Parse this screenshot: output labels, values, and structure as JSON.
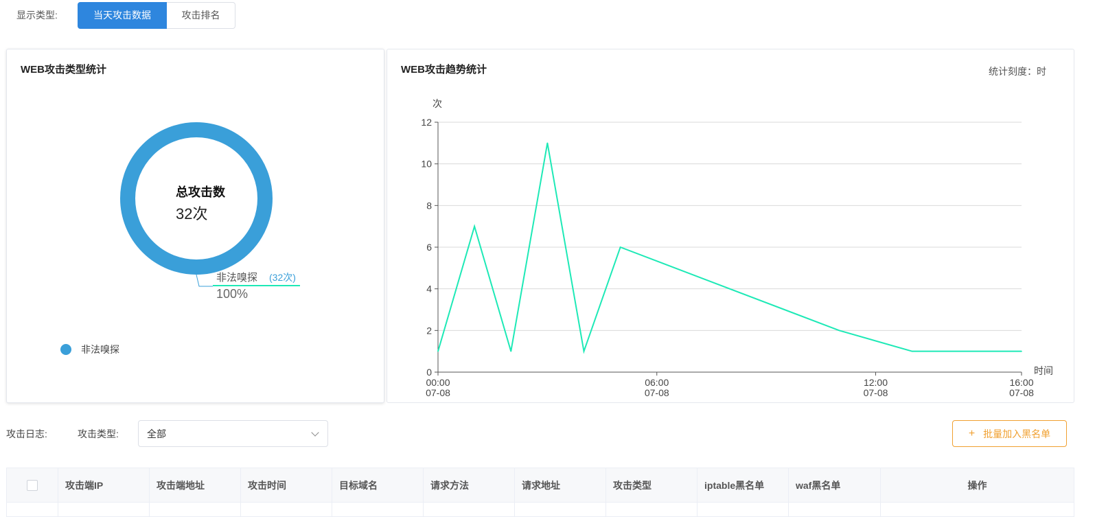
{
  "display_type": {
    "label": "显示类型:",
    "options": [
      "当天攻击数据",
      "攻击排名"
    ],
    "active_index": 0
  },
  "pie_card": {
    "title": "WEB攻击类型统计",
    "center_title": "总攻击数",
    "center_value": "32次",
    "slice_label_name": "非法嗅探",
    "slice_label_count": "(32次)",
    "slice_label_pct": "100%",
    "legend": [
      {
        "name": "非法嗅探",
        "color": "#3a9fd9"
      }
    ]
  },
  "line_card": {
    "title": "WEB攻击趋势统计",
    "scale_label": "统计刻度：时"
  },
  "chart_data": [
    {
      "type": "pie",
      "categories": [
        "非法嗅探"
      ],
      "values": [
        32
      ],
      "title": "WEB攻击类型统计",
      "colors": [
        "#3a9fd9"
      ]
    },
    {
      "type": "line",
      "title": "WEB攻击趋势统计",
      "xlabel": "时间",
      "ylabel": "次",
      "ylim": [
        0,
        12
      ],
      "yticks": [
        0,
        2,
        4,
        6,
        8,
        10,
        12
      ],
      "xlim_hours": [
        0,
        16
      ],
      "xticks": [
        {
          "hour": 0,
          "label1": "00:00",
          "label2": "07-08"
        },
        {
          "hour": 6,
          "label1": "06:00",
          "label2": "07-08"
        },
        {
          "hour": 12,
          "label1": "12:00",
          "label2": "07-08"
        },
        {
          "hour": 16,
          "label1": "16:00",
          "label2": "07-08"
        }
      ],
      "series": [
        {
          "color": "#1de9b6",
          "x": [
            0,
            1,
            2,
            3,
            4,
            5,
            11,
            13,
            16
          ],
          "y": [
            1,
            7,
            1,
            11,
            1,
            6,
            2,
            1,
            1
          ]
        }
      ],
      "grid": true
    }
  ],
  "filters": {
    "log_label": "攻击日志:",
    "type_label": "攻击类型:",
    "type_value": "全部"
  },
  "batch_button": {
    "icon": "+",
    "label": "批量加入黑名单"
  },
  "table": {
    "columns": [
      "攻击端IP",
      "攻击端地址",
      "攻击时间",
      "目标域名",
      "请求方法",
      "请求地址",
      "攻击类型",
      "iptable黑名单",
      "waf黑名单",
      "操作"
    ]
  }
}
